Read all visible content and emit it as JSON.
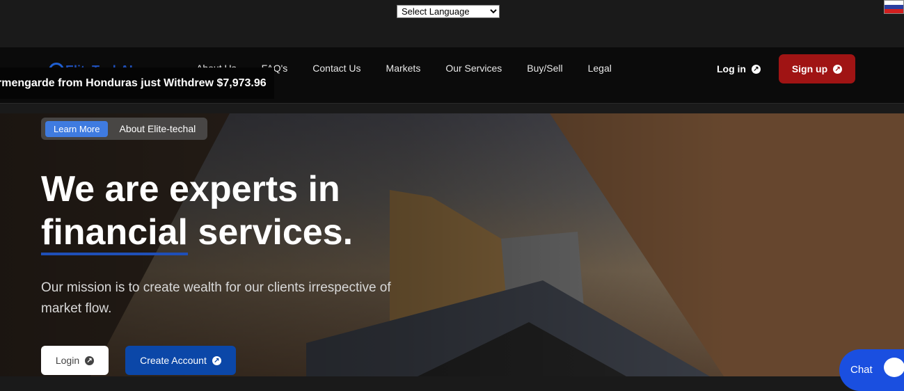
{
  "language_select": {
    "selected": "Select Language"
  },
  "nav": {
    "logo_text": "EliteTechAI",
    "links": [
      "About Us",
      "FAQ's",
      "Contact Us",
      "Markets",
      "Our Services",
      "Buy/Sell",
      "Legal"
    ],
    "login_label": "Log in",
    "signup_label": "Sign up"
  },
  "ticker": {
    "text": "rmengarde from Honduras just Withdrew $7,973.96"
  },
  "hero": {
    "pill_button": "Learn More",
    "pill_text": "About Elite-techal",
    "headline_line1": "We are experts in",
    "headline_underlined": "financial",
    "headline_rest": " services.",
    "mission": "Our mission is to create wealth for our clients irrespective of market flow.",
    "login_button": "Login",
    "create_button": "Create Account"
  },
  "chat": {
    "label": "Chat"
  },
  "colors": {
    "signup": "#a01414",
    "create": "#0b47a8",
    "pill_button": "#3f7be0",
    "chat": "#1a4fe0"
  },
  "icons": {
    "arrow": "arrow-up-right-circle-icon",
    "chat": "chat-bubble-icon",
    "flag": "flag-icon"
  }
}
